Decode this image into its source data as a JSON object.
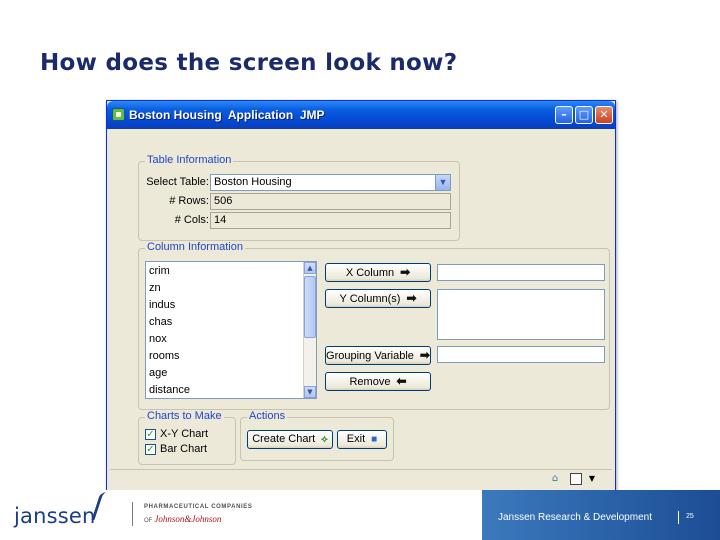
{
  "slide": {
    "title": "How does the screen look now?"
  },
  "window": {
    "title": "Boston Housing  Application  JMP",
    "buttons": {
      "minimize": "–",
      "maximize": "□",
      "close": "✕"
    }
  },
  "table_information": {
    "legend": "Table Information",
    "select_table_label": "Select Table:",
    "select_table_value": "Boston Housing",
    "rows_label": "# Rows:",
    "rows_value": "506",
    "cols_label": "# Cols:",
    "cols_value": "14"
  },
  "column_information": {
    "legend": "Column Information",
    "columns": [
      "crim",
      "zn",
      "indus",
      "chas",
      "nox",
      "rooms",
      "age",
      "distance"
    ],
    "x_column_label": "X Column",
    "y_columns_label": "Y Column(s)",
    "grouping_label": "Grouping Variable",
    "remove_label": "Remove",
    "x_column_value": "",
    "y_columns_value": "",
    "grouping_value": ""
  },
  "charts_to_make": {
    "legend": "Charts to Make",
    "options": [
      {
        "label": "X-Y Chart",
        "checked": true
      },
      {
        "label": "Bar Chart",
        "checked": true
      }
    ]
  },
  "actions": {
    "legend": "Actions",
    "create_chart_label": "Create Chart",
    "exit_label": "Exit"
  },
  "statusbar": {
    "icons": [
      "home-icon",
      "square-icon",
      "dropdown-icon"
    ]
  },
  "footer": {
    "brand": "janssen",
    "pharma_line": "PHARMACEUTICAL COMPANIES",
    "of": "OF",
    "jnj": "Johnson&Johnson",
    "division": "Janssen Research & Development",
    "page": "25"
  },
  "colors": {
    "title": "#1b2a6b",
    "group_label": "#1f45c9",
    "titlebar": "#0449d4",
    "footer_band": "#2a62aa"
  }
}
